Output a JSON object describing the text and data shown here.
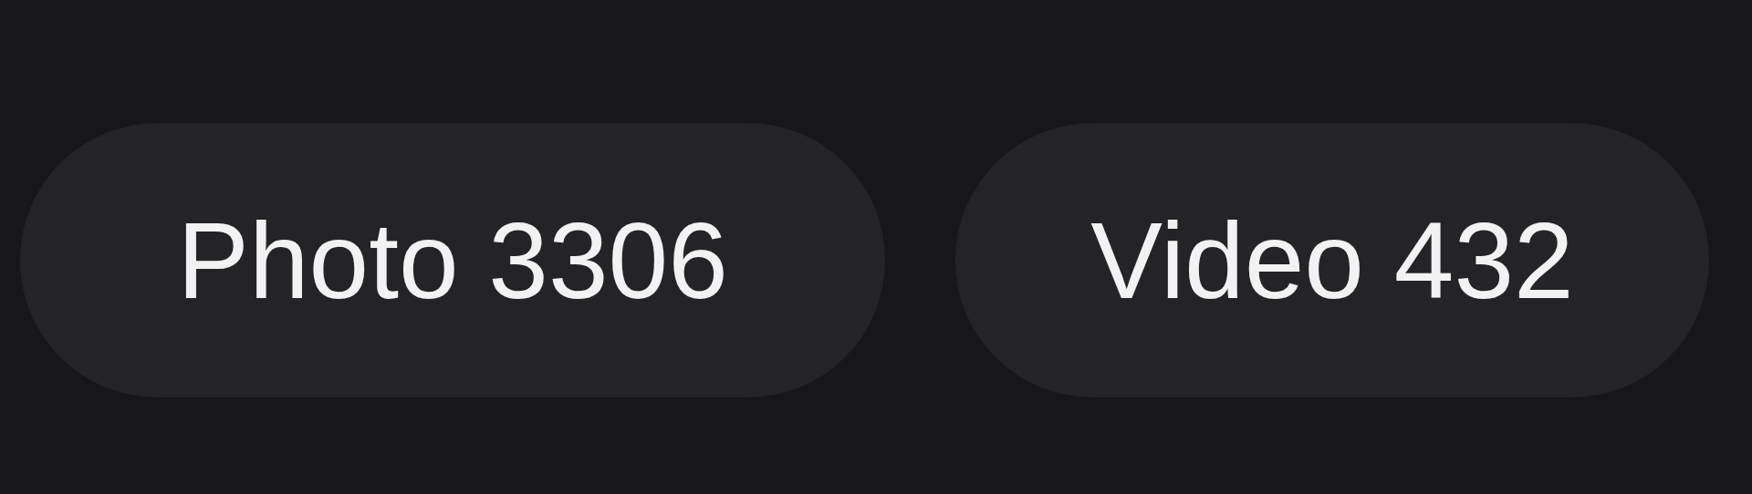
{
  "tabs": [
    {
      "label": "Photo 3306"
    },
    {
      "label": "Video 432"
    }
  ]
}
